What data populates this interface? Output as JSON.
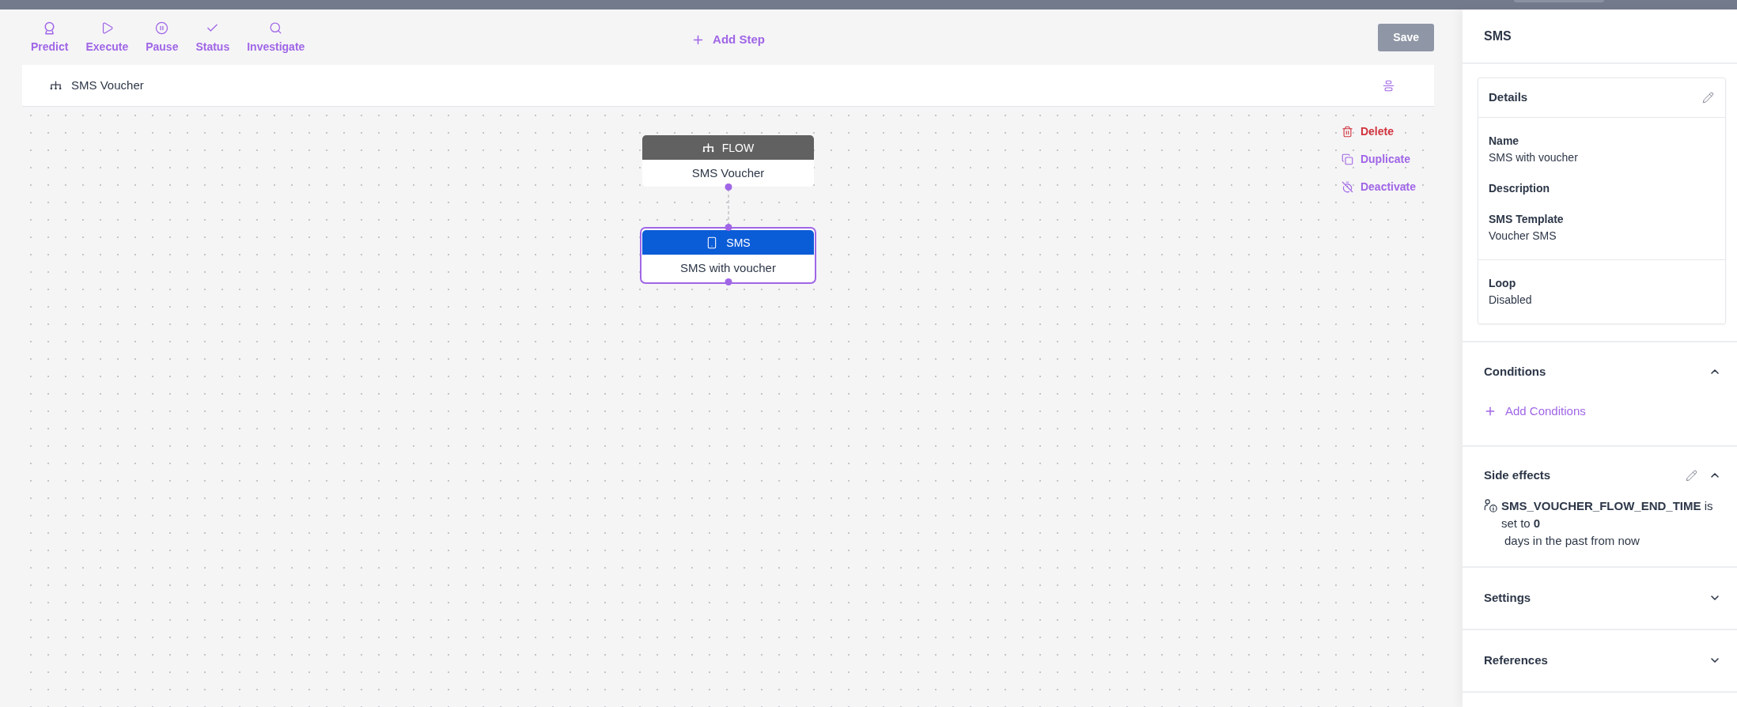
{
  "toolbar": {
    "actions": [
      {
        "kind": "predict",
        "label": "Predict"
      },
      {
        "kind": "execute",
        "label": "Execute"
      },
      {
        "kind": "pause",
        "label": "Pause"
      },
      {
        "kind": "status",
        "label": "Status"
      },
      {
        "kind": "investigate",
        "label": "Investigate"
      }
    ],
    "add_step": "Add Step",
    "save": "Save"
  },
  "canvas": {
    "title": "SMS Voucher",
    "actions": [
      {
        "kind": "delete",
        "label": "Delete"
      },
      {
        "kind": "duplicate",
        "label": "Duplicate"
      },
      {
        "kind": "deactivate",
        "label": "Deactivate"
      }
    ],
    "nodes": [
      {
        "kind": "flow",
        "type_label": "FLOW",
        "title": "SMS Voucher",
        "selected": false
      },
      {
        "kind": "sms",
        "type_label": "SMS",
        "title": "SMS with voucher",
        "selected": true
      }
    ]
  },
  "panel": {
    "title": "SMS",
    "details": {
      "title": "Details",
      "groups": [
        {
          "fields": [
            {
              "label": "Name",
              "value": "SMS with voucher"
            },
            {
              "label": "Description"
            },
            {
              "label": "SMS Template",
              "value": "Voucher SMS"
            }
          ]
        },
        {
          "fields": [
            {
              "label": "Loop",
              "value": "Disabled"
            }
          ]
        }
      ]
    },
    "sections": [
      {
        "kind": "conditions",
        "title": "Conditions",
        "expanded": true,
        "add_label": "Add Conditions"
      },
      {
        "kind": "side_effects",
        "title": "Side effects",
        "expanded": true,
        "effects": [
          {
            "text": "**SMS_VOUCHER_FLOW_END_TIME** is set to **0**",
            "suffix": "days in the past from now"
          }
        ]
      },
      {
        "kind": "settings",
        "title": "Settings",
        "expanded": false
      },
      {
        "kind": "references",
        "title": "References",
        "expanded": false
      }
    ]
  }
}
